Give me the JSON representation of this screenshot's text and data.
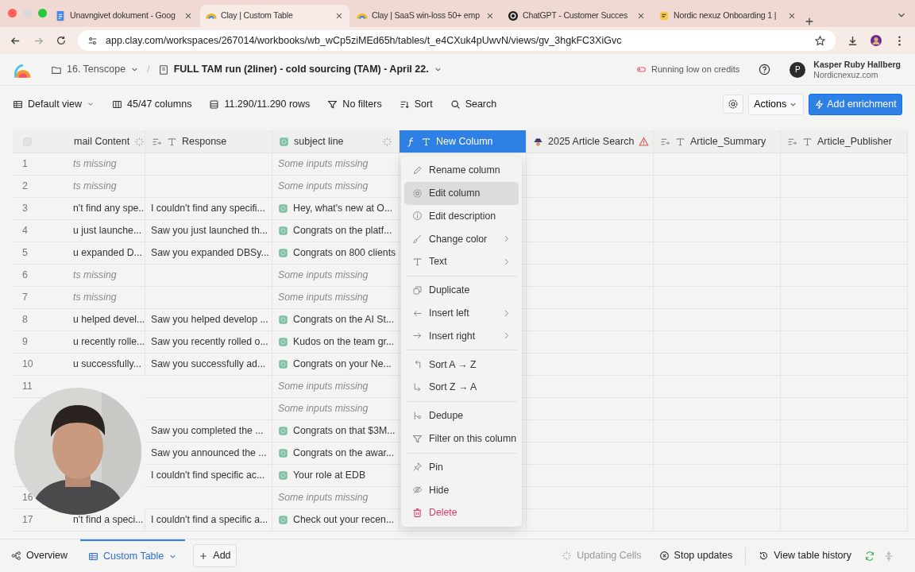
{
  "browser": {
    "tabs": [
      {
        "title": "Unavngivet dokument - Goog",
        "selected": false
      },
      {
        "title": "Clay | Custom Table",
        "selected": true
      },
      {
        "title": "Clay | SaaS win-loss 50+ emp",
        "selected": false
      },
      {
        "title": "ChatGPT - Customer Succes",
        "selected": false
      },
      {
        "title": "Nordic nexuz Onboarding 1 |",
        "selected": false
      }
    ],
    "url": "app.clay.com/workspaces/267014/workbooks/wb_wCp5ziMEd65h/tables/t_e4CXuk4pUwvN/views/gv_3hgkFC3XiGvc"
  },
  "header": {
    "workspace": "16. Tenscope",
    "separator": "/",
    "workbook": "FULL TAM run (2liner) - cold sourcing (TAM) - April 22.",
    "credits": "Running low on credits",
    "user": {
      "initial": "P",
      "name": "Kasper Ruby Hallberg",
      "org": "Nordicnexuz.com"
    }
  },
  "toolbar": {
    "view": "Default view",
    "columns": "45/47 columns",
    "rows": "11.290/11.290 rows",
    "filters": "No filters",
    "sort": "Sort",
    "search": "Search",
    "actions": "Actions",
    "enrichment": "Add enrichment"
  },
  "table": {
    "select_all": {
      "checked": false
    },
    "columns": [
      {
        "title": "mail Content",
        "kind": "plain",
        "loading": true,
        "warning": false,
        "selected": false
      },
      {
        "title": "Response",
        "kind": "text",
        "loading": false,
        "warning": false,
        "selected": false
      },
      {
        "title": "subject line",
        "kind": "ai",
        "loading": true,
        "warning": false,
        "selected": false
      },
      {
        "title": "New Column",
        "kind": "formula",
        "loading": false,
        "warning": false,
        "selected": true
      },
      {
        "title": "2025 Article Search",
        "kind": "agent",
        "loading": false,
        "warning": true,
        "selected": false
      },
      {
        "title": "Article_Summary",
        "kind": "text",
        "loading": false,
        "warning": false,
        "selected": false
      },
      {
        "title": "Article_Publisher",
        "kind": "text",
        "loading": false,
        "warning": false,
        "selected": false
      }
    ],
    "rows": [
      {
        "number": "1",
        "email": {
          "text": "ts missing",
          "kind": "missing"
        },
        "subject": {
          "text": "Some inputs missing",
          "kind": "missing"
        }
      },
      {
        "number": "2",
        "email": {
          "text": "ts missing",
          "kind": "missing"
        },
        "subject": {
          "text": "Some inputs missing",
          "kind": "missing"
        }
      },
      {
        "number": "3",
        "email": {
          "text": "n't find any spe...",
          "kind": "plain"
        },
        "response": {
          "text": "I couldn't find any specifi...",
          "kind": "plain"
        },
        "subject": {
          "text": "Hey, what's new at O...",
          "kind": "ai"
        }
      },
      {
        "number": "4",
        "email": {
          "text": "u just launche...",
          "kind": "plain"
        },
        "response": {
          "text": "Saw you just launched th...",
          "kind": "plain"
        },
        "subject": {
          "text": "Congrats on the platf...",
          "kind": "ai"
        }
      },
      {
        "number": "5",
        "email": {
          "text": "u expanded D...",
          "kind": "plain"
        },
        "response": {
          "text": "Saw you expanded DBSy...",
          "kind": "plain"
        },
        "subject": {
          "text": "Congrats on 800 clients",
          "kind": "ai"
        }
      },
      {
        "number": "6",
        "email": {
          "text": "ts missing",
          "kind": "missing"
        },
        "subject": {
          "text": "Some inputs missing",
          "kind": "missing"
        }
      },
      {
        "number": "7",
        "email": {
          "text": "ts missing",
          "kind": "missing"
        },
        "subject": {
          "text": "Some inputs missing",
          "kind": "missing"
        }
      },
      {
        "number": "8",
        "email": {
          "text": "u helped devel...",
          "kind": "plain"
        },
        "response": {
          "text": "Saw you helped develop ...",
          "kind": "plain"
        },
        "subject": {
          "text": "Congrats on the AI St...",
          "kind": "ai"
        }
      },
      {
        "number": "9",
        "email": {
          "text": "u recently rolle...",
          "kind": "plain"
        },
        "response": {
          "text": "Saw you recently rolled o...",
          "kind": "plain"
        },
        "subject": {
          "text": "Kudos on the team gr...",
          "kind": "ai"
        }
      },
      {
        "number": "10",
        "email": {
          "text": "u successfully...",
          "kind": "plain"
        },
        "response": {
          "text": "Saw you successfully ad...",
          "kind": "plain"
        },
        "subject": {
          "text": "Congrats on your Ne...",
          "kind": "ai"
        }
      },
      {
        "number": "11",
        "subject": {
          "text": "Some inputs missing",
          "kind": "missing"
        }
      },
      {
        "subject": {
          "text": "Some inputs missing",
          "kind": "missing"
        }
      },
      {
        "response": {
          "text": "Saw you completed the ...",
          "kind": "plain"
        },
        "subject": {
          "text": "Congrats on that $3M...",
          "kind": "ai"
        }
      },
      {
        "response": {
          "text": "Saw you announced the ...",
          "kind": "plain"
        },
        "subject": {
          "text": "Congrats on the awar...",
          "kind": "ai"
        }
      },
      {
        "response": {
          "text": "I couldn't find specific ac...",
          "kind": "plain"
        },
        "subject": {
          "text": "Your role at EDB",
          "kind": "ai"
        }
      },
      {
        "number": "16",
        "subject": {
          "text": "Some inputs missing",
          "kind": "missing"
        }
      },
      {
        "number": "17",
        "email": {
          "text": "n't find a speci...",
          "kind": "plain"
        },
        "response": {
          "text": "I couldn't find a specific a...",
          "kind": "plain"
        },
        "subject": {
          "text": "Check out your recen...",
          "kind": "ai"
        }
      }
    ]
  },
  "column_menu": {
    "groups": [
      [
        {
          "label": "Rename column",
          "submenu": false,
          "hovered": false
        },
        {
          "label": "Edit column",
          "submenu": false,
          "hovered": true
        },
        {
          "label": "Edit description",
          "submenu": false,
          "hovered": false
        },
        {
          "label": "Change color",
          "submenu": true,
          "hovered": false
        },
        {
          "label": "Text",
          "submenu": true,
          "hovered": false
        }
      ],
      [
        {
          "label": "Duplicate",
          "submenu": false,
          "hovered": false
        },
        {
          "label": "Insert left",
          "submenu": true,
          "hovered": false
        },
        {
          "label": "Insert right",
          "submenu": true,
          "hovered": false
        }
      ],
      [
        {
          "label": "Sort A → Z",
          "submenu": false,
          "hovered": false
        },
        {
          "label": "Sort Z → A",
          "submenu": false,
          "hovered": false
        }
      ],
      [
        {
          "label": "Dedupe",
          "submenu": false,
          "hovered": false
        },
        {
          "label": "Filter on this column",
          "submenu": false,
          "hovered": false
        }
      ],
      [
        {
          "label": "Pin",
          "submenu": false,
          "hovered": false
        },
        {
          "label": "Hide",
          "submenu": false,
          "hovered": false
        },
        {
          "label": "Delete",
          "kind": "danger",
          "submenu": false,
          "hovered": false
        }
      ]
    ]
  },
  "footer": {
    "overview": "Overview",
    "tabs": [
      {
        "label": "Custom Table",
        "selected": true
      }
    ],
    "add": "Add",
    "updating": "Updating Cells",
    "stop": "Stop updates",
    "history": "View table history"
  }
}
